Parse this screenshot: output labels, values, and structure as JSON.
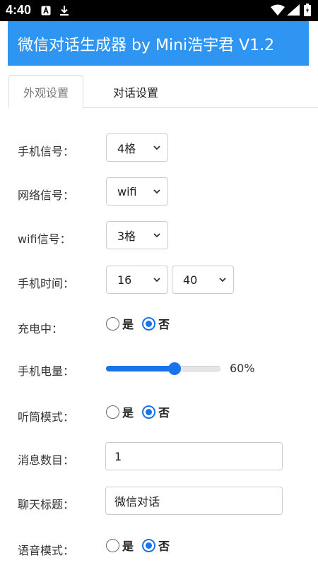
{
  "statusbar": {
    "time": "4:40"
  },
  "appbar": {
    "title": "微信对话生成器 by Mini浩宇君 V1.2",
    "color": "#2f95f3"
  },
  "tabs": [
    {
      "label": "外观设置",
      "active": true
    },
    {
      "label": "对话设置",
      "active": false
    }
  ],
  "settings": {
    "phone_signal": {
      "label": "手机信号：",
      "value": "4格"
    },
    "network_signal": {
      "label": "网络信号：",
      "value": "wifi"
    },
    "wifi_signal": {
      "label": "wifi信号：",
      "value": "3格"
    },
    "phone_time": {
      "label": "手机时间：",
      "hour": "16",
      "minute": "40"
    },
    "charging": {
      "label": "充电中：",
      "yes": "是",
      "no": "否",
      "selected": "否"
    },
    "battery": {
      "label": "手机电量：",
      "value_text": "60%",
      "value": 0.6
    },
    "earpiece_mode": {
      "label": "听筒模式：",
      "yes": "是",
      "no": "否",
      "selected": "否"
    },
    "message_count": {
      "label": "消息数目：",
      "value": "1"
    },
    "chat_title": {
      "label": "聊天标题：",
      "value": "微信对话"
    },
    "voice_mode": {
      "label": "语音模式：",
      "yes": "是",
      "no": "否",
      "selected": "否"
    }
  },
  "accent_color": "#1a73e8"
}
